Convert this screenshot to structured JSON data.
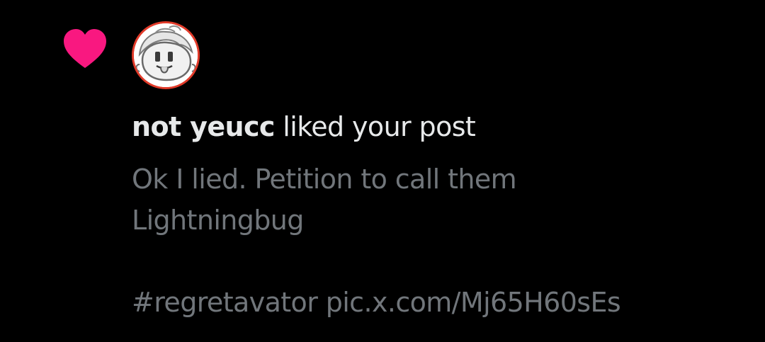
{
  "notification": {
    "type_icon": "heart-icon",
    "type_color": "#f91880",
    "user": {
      "display_name": "not yeucc",
      "avatar": "avatar-icon"
    },
    "action_text": " liked your post",
    "post": {
      "line1": "Ok I lied. Petition to call them",
      "line2": "Lightningbug",
      "line3": "#regretavator pic.x.com/Mj65H60sEs"
    }
  },
  "colors": {
    "background": "#000000",
    "primary_text": "#e7e9ea",
    "secondary_text": "#71767b",
    "like": "#f91880",
    "avatar_border": "#e23b2a"
  }
}
